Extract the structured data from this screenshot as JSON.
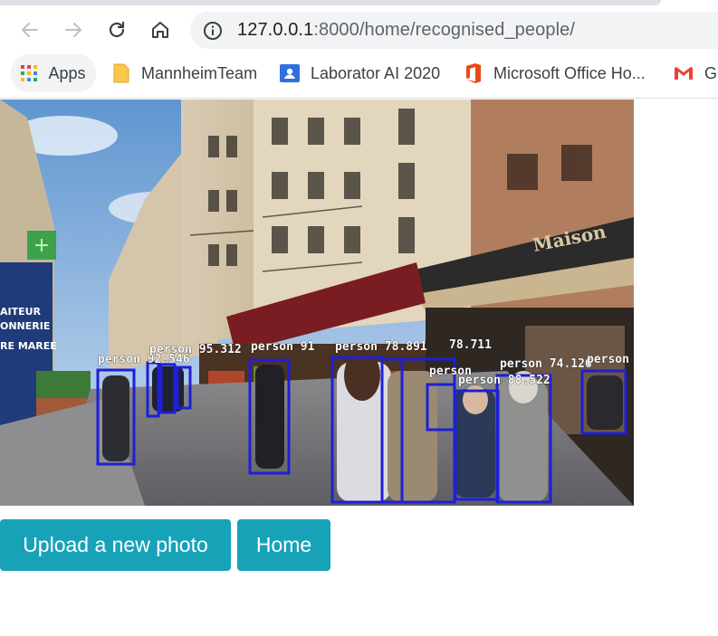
{
  "browser": {
    "url_host": "127.0.0.1",
    "url_port": ":8000",
    "url_path": "/home/recognised_people/",
    "bookmarks": [
      {
        "label": "Apps",
        "icon": "apps-grid-icon"
      },
      {
        "label": "MannheimTeam",
        "icon": "folder-icon"
      },
      {
        "label": "Laborator AI 2020",
        "icon": "classroom-icon"
      },
      {
        "label": "Microsoft Office Ho...",
        "icon": "office-icon"
      },
      {
        "label": "Gr",
        "icon": "gmail-icon"
      }
    ]
  },
  "photo": {
    "shop_sign": "Maison",
    "storefront_lines": [
      "AITEUR",
      "ONNERIE",
      "RE MAREE"
    ],
    "detections": [
      {
        "label": "person 92.546"
      },
      {
        "label": "person 95.312"
      },
      {
        "label": "person 91"
      },
      {
        "label": "person 78.891"
      },
      {
        "label": "78.711"
      },
      {
        "label": "person"
      },
      {
        "label": "person 74.126"
      },
      {
        "label": "person 88.522"
      },
      {
        "label": "person"
      }
    ]
  },
  "actions": {
    "upload_label": "Upload a new photo",
    "home_label": "Home"
  },
  "colors": {
    "button_bg": "#17a2b8",
    "detection_box": "#1f1fd6"
  }
}
